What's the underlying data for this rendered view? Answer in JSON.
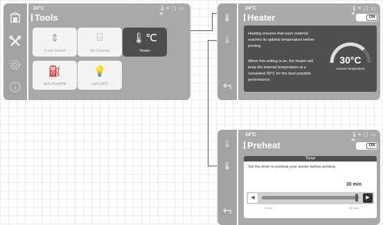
{
  "tools_screen": {
    "temperature": "24°C",
    "status_icons": "🌡≡ ▢ ▭ ≋",
    "title": "Tools",
    "sidebar": [
      "home-icon",
      "tools-icon",
      "settings-icon",
      "info-icon"
    ],
    "tiles": [
      {
        "label": "Z-axis Control",
        "icon": "⇕"
      },
      {
        "label": "Vat Cleaning",
        "icon": "⌸"
      },
      {
        "label": "Heater",
        "icon": "🌡℃"
      },
      {
        "label": "Auto-Pump/Fill",
        "icon": "⛽"
      },
      {
        "label": "Light (OFF)",
        "icon": "💡"
      }
    ]
  },
  "heater_screen": {
    "temperature": "24°C",
    "status_icons": "🌡≡ ▢ ▭ ≋",
    "title": "Heater",
    "toggle": "ON",
    "paragraph1": [
      "Heating ensures that each material",
      "reaches its optimal temperature before",
      "printing."
    ],
    "paragraph2": [
      "When this setting is on, the heater will",
      "keep the internal temperature at a",
      "consistent 30°C for the best possible",
      "performance."
    ],
    "gauge_value": "30°C",
    "gauge_label": "Current Temperature",
    "gauge_fraction": 0.75
  },
  "preheat_screen": {
    "temperature": "24°C",
    "status_icons": "🌡≡ ▢ ▭ ≋",
    "title": "Preheat",
    "toggle": "ON",
    "timer_header": "Timer",
    "description": "Set the timer to preheat your printer before printing.",
    "value": "30 min",
    "min_label": "5 min",
    "max_label": "30 min",
    "slider_fraction": 1.0,
    "decrease_icon": "◀",
    "increase_icon": "▶"
  },
  "colors": {
    "screen": "#a9a9a9",
    "panel": "#4f4f4f",
    "tile_active": "#4d4d4d",
    "tile": "#f4f4f4"
  }
}
